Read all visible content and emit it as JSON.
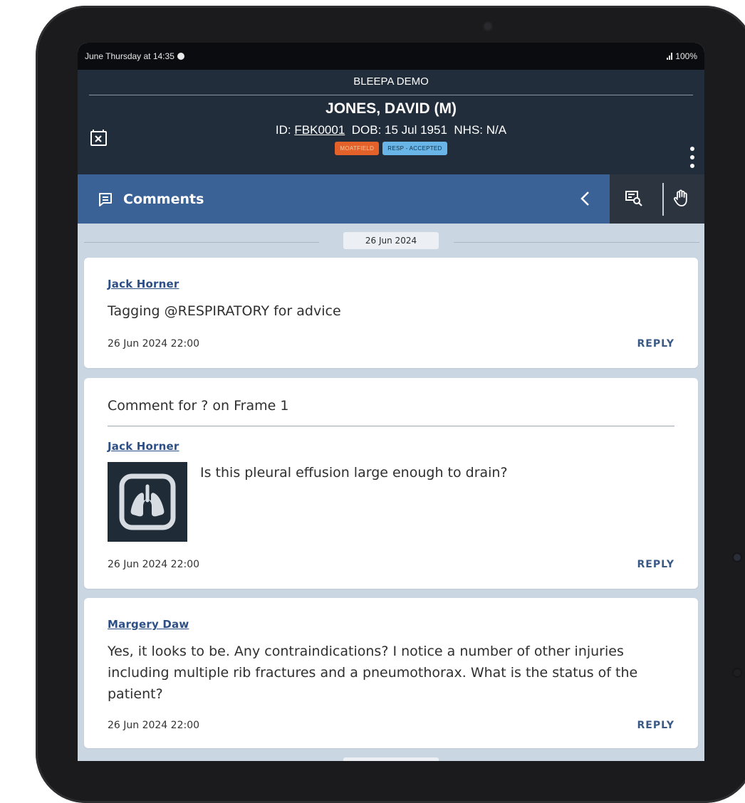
{
  "status_bar": {
    "left_text": "June Thursday at 14:35",
    "right_text": "100%"
  },
  "header": {
    "app_name": "BLEEPA DEMO",
    "patient_name": "JONES, DAVID (M)",
    "id_label": "ID:",
    "id_value": "FBK0001",
    "dob": "DOB: 15 Jul 1951",
    "nhs": "NHS: N/A",
    "badges": [
      {
        "label": "MOATFIELD",
        "color": "#e4622a"
      },
      {
        "label": "RESP - ACCEPTED",
        "color": "#69b5e8"
      }
    ]
  },
  "section": {
    "title": "Comments"
  },
  "feed": {
    "date_chip": "26 Jun 2024",
    "comments": [
      {
        "author": "Jack Horner",
        "text": "Tagging @RESPIRATORY for advice",
        "timestamp": "26 Jun 2024 22:00",
        "reply_label": "REPLY"
      },
      {
        "frame_title": "Comment for ? on Frame 1",
        "author": "Jack Horner",
        "text": "Is this pleural effusion large enough to drain?",
        "timestamp": "26 Jun 2024 22:00",
        "reply_label": "REPLY",
        "thumbnail_icon": "lungs-icon"
      },
      {
        "author": "Margery Daw",
        "text": "Yes, it looks to be. Any contraindications? I notice a number of other injuries including multiple rib fractures and a pneumothorax. What is the status of the patient?",
        "timestamp": "26 Jun 2024 22:00",
        "reply_label": "REPLY"
      }
    ]
  },
  "colors": {
    "header_bg": "#222d3b",
    "section_bar_bg": "#3b6297",
    "feed_bg": "#cbd6e3",
    "author_link": "#2d4f86"
  }
}
